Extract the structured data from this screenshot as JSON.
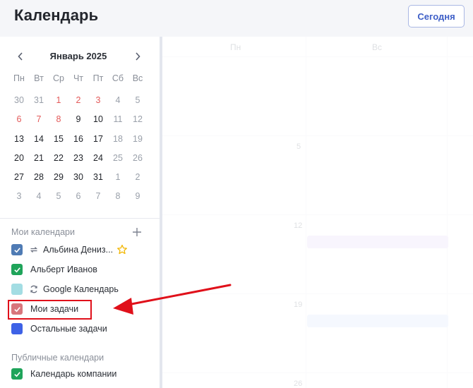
{
  "header": {
    "title": "Календарь",
    "today_label": "Сегодня"
  },
  "mini_calendar": {
    "month_label": "Январь 2025",
    "weekdays": [
      "Пн",
      "Вт",
      "Ср",
      "Чт",
      "Пт",
      "Сб",
      "Вс"
    ],
    "weeks": [
      [
        "30",
        "31",
        "1",
        "2",
        "3",
        "4",
        "5"
      ],
      [
        "6",
        "7",
        "8",
        "9",
        "10",
        "11",
        "12"
      ],
      [
        "13",
        "14",
        "15",
        "16",
        "17",
        "18",
        "19"
      ],
      [
        "20",
        "21",
        "22",
        "23",
        "24",
        "25",
        "26"
      ],
      [
        "27",
        "28",
        "29",
        "30",
        "31",
        "1",
        "2"
      ],
      [
        "3",
        "4",
        "5",
        "6",
        "7",
        "8",
        "9"
      ]
    ]
  },
  "my_calendars": {
    "title": "Мои календари",
    "items": [
      {
        "label": "Альбина Дениз...",
        "color": "#4f7bb4",
        "sync": true,
        "starred": true
      },
      {
        "label": "Альберт Иванов",
        "color": "#1fa45a"
      },
      {
        "label": "Google Календарь",
        "color": "#a3dde3",
        "sync": true
      },
      {
        "label": "Мои задачи",
        "color": "#d8767c"
      },
      {
        "label": "Остальные задачи",
        "color": "#3e62e6"
      }
    ]
  },
  "public_calendars": {
    "title": "Публичные календари",
    "items": [
      {
        "label": "Календарь компании",
        "color": "#1fa45a"
      }
    ]
  },
  "main": {
    "day_headers": [
      "Пн",
      "Вс"
    ],
    "day_numbers": [
      "",
      "",
      "5",
      "",
      "12",
      "",
      "19",
      "",
      "26",
      ""
    ]
  },
  "colors": {
    "accent": "#3e5fc7",
    "highlight": "#e0101a",
    "weekend_holiday": "#e35a5a"
  }
}
